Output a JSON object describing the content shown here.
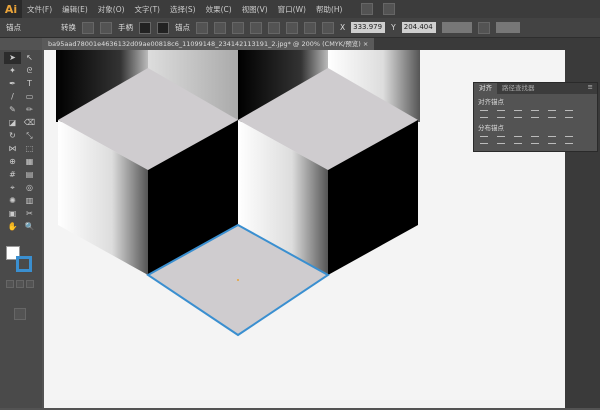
{
  "app": {
    "logo": "Ai"
  },
  "menu": [
    "文件(F)",
    "编辑(E)",
    "对象(O)",
    "文字(T)",
    "选择(S)",
    "效果(C)",
    "视图(V)",
    "窗口(W)",
    "帮助(H)"
  ],
  "control": {
    "selection_label": "锚点",
    "convert_label": "转换",
    "handle_label": "手柄",
    "anchor_label": "锚点",
    "x_value": "333.979",
    "y_value": "204.404"
  },
  "document_tab": {
    "title": "ba95aad78001e4636132d09ae00818c6_11099148_234142113191_2.jpg* @ 200% (CMYK/预览)"
  },
  "panel": {
    "tabs": [
      "对齐",
      "路径查找器"
    ],
    "align_label": "对齐锚点",
    "distribute_label": "分布锚点"
  },
  "colors": {
    "selection": "#3a8fd0",
    "accent": "#e8a33a"
  }
}
